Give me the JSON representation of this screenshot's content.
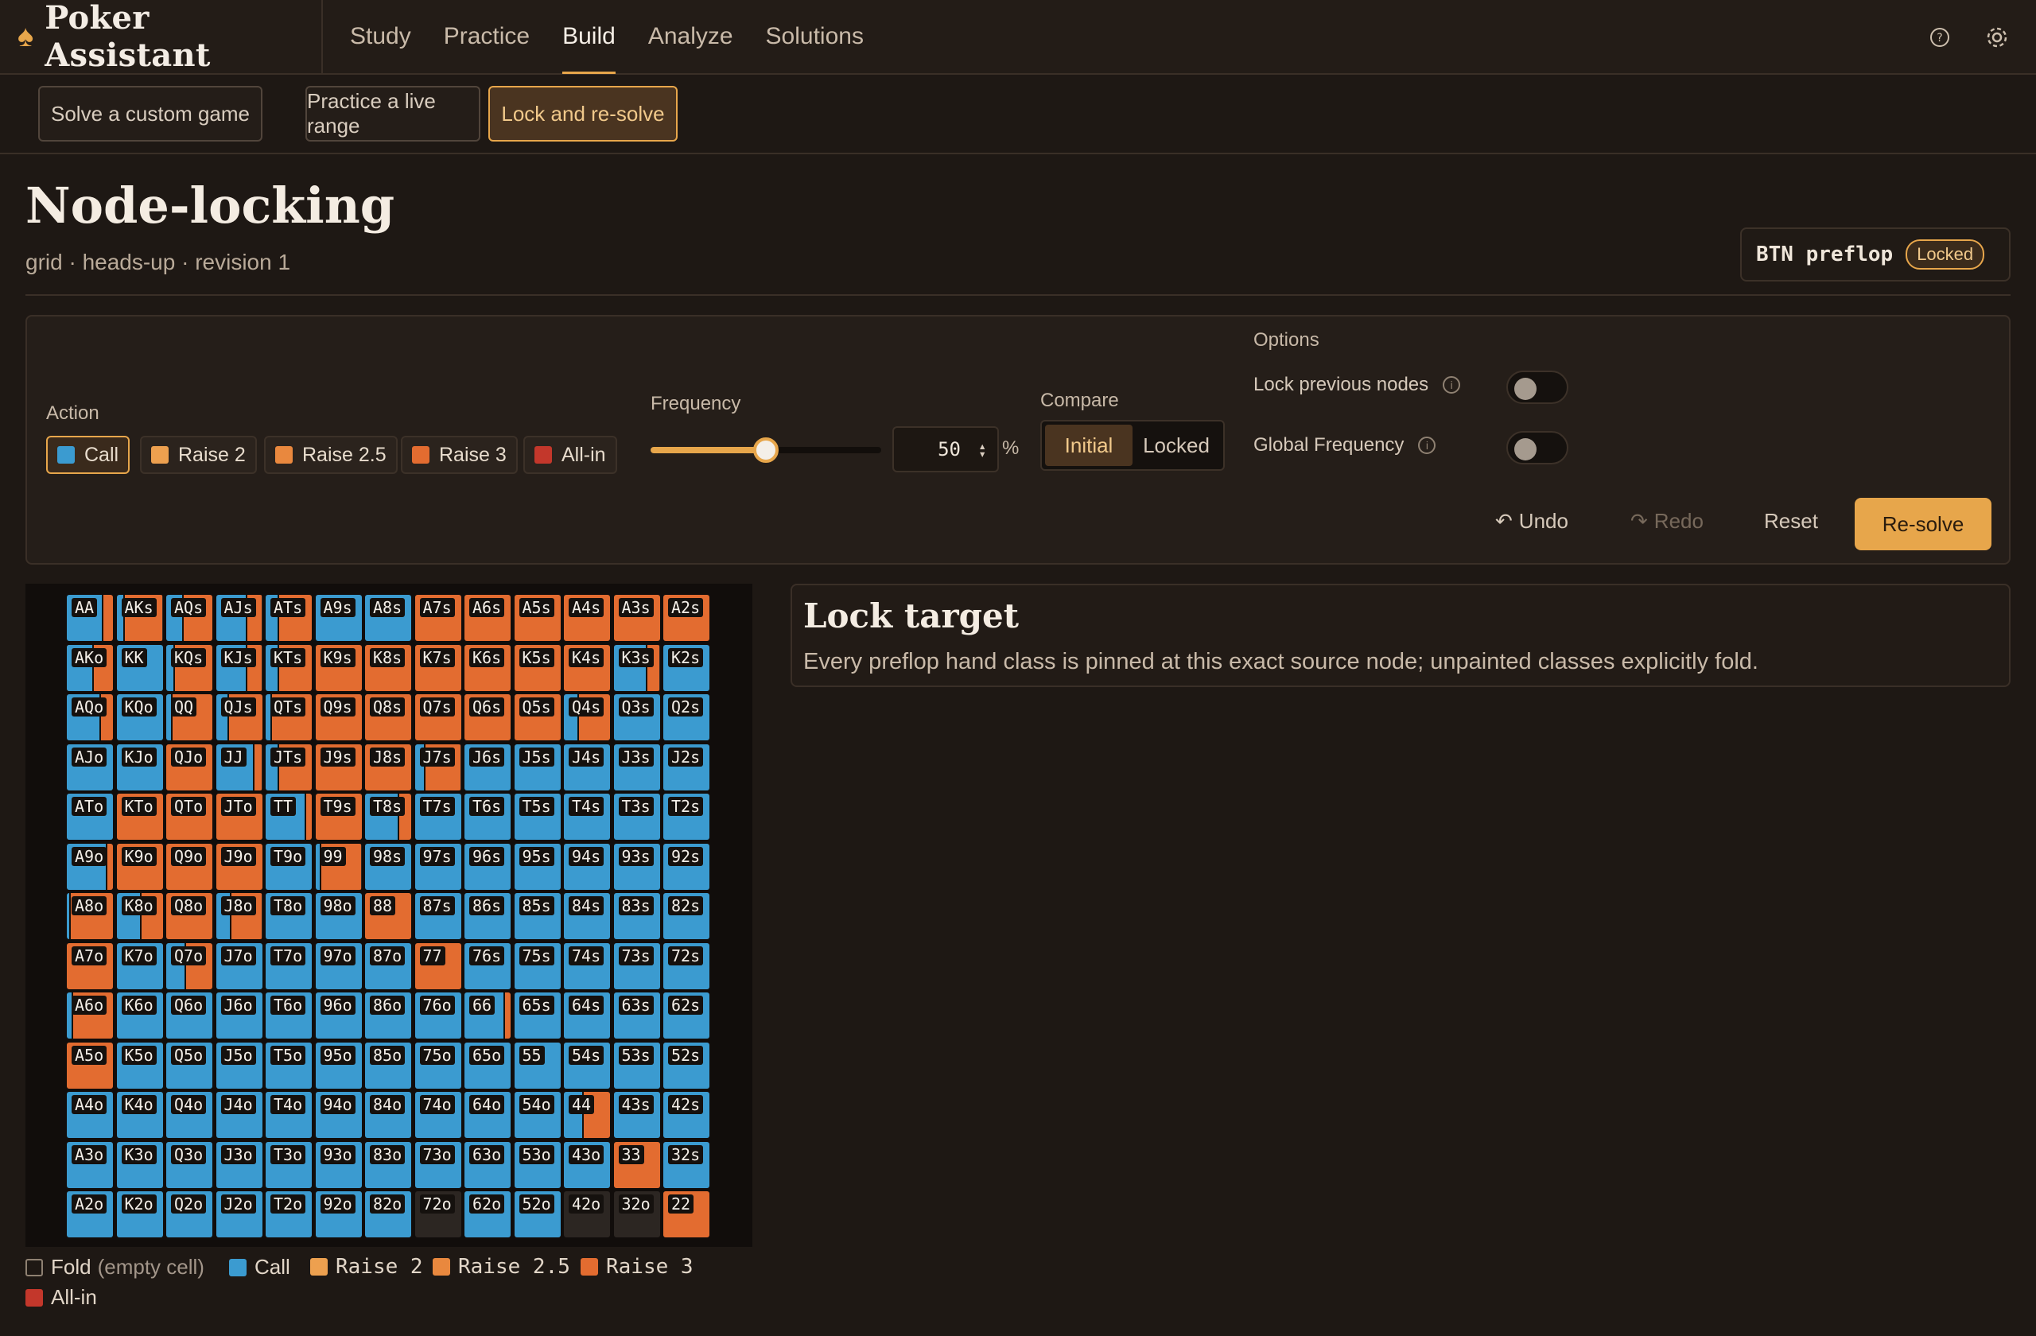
{
  "app": {
    "title": "Poker Assistant"
  },
  "nav": {
    "items": [
      "Study",
      "Practice",
      "Build",
      "Analyze",
      "Solutions"
    ],
    "active": "Build"
  },
  "subnav": {
    "tabs": [
      "Solve a custom game",
      "Practice a live range",
      "Lock and re-solve"
    ],
    "active": "Lock and re-solve"
  },
  "page": {
    "title": "Node-locking",
    "subtitle": "grid · heads-up · revision 1"
  },
  "node": {
    "label": "BTN preflop",
    "badge": "Locked"
  },
  "controls": {
    "action_label": "Action",
    "actions": [
      {
        "label": "Call",
        "color": "#3b9bd0"
      },
      {
        "label": "Raise 2",
        "color": "#eda04f"
      },
      {
        "label": "Raise 2.5",
        "color": "#e9883e"
      },
      {
        "label": "Raise 3",
        "color": "#e36c30"
      },
      {
        "label": "All-in",
        "color": "#c3372b"
      }
    ],
    "active_action": "Call",
    "frequency_label": "Frequency",
    "frequency_value": 50,
    "frequency_unit": "%",
    "compare_label": "Compare",
    "compare_options": [
      "Initial",
      "Locked"
    ],
    "compare_active": "Initial",
    "options_label": "Options",
    "options": [
      {
        "label": "Lock previous nodes",
        "enabled": false
      },
      {
        "label": "Global Frequency",
        "enabled": false
      }
    ],
    "undo": "Undo",
    "redo": "Redo",
    "reset": "Reset",
    "resolve": "Re-solve"
  },
  "lock_target": {
    "title": "Lock target",
    "description": "Every preflop hand class is pinned at this exact source node; unpainted classes explicitly fold."
  },
  "grid": {
    "selected": "AKo",
    "rows": [
      [
        "AA",
        "AKs",
        "AQs",
        "AJs",
        "ATs",
        "A9s",
        "A8s",
        "A7s",
        "A6s",
        "A5s",
        "A4s",
        "A3s",
        "A2s"
      ],
      [
        "AKo",
        "KK",
        "KQs",
        "KJs",
        "KTs",
        "K9s",
        "K8s",
        "K7s",
        "K6s",
        "K5s",
        "K4s",
        "K3s",
        "K2s"
      ],
      [
        "AQo",
        "KQo",
        "QQ",
        "QJs",
        "QTs",
        "Q9s",
        "Q8s",
        "Q7s",
        "Q6s",
        "Q5s",
        "Q4s",
        "Q3s",
        "Q2s"
      ],
      [
        "AJo",
        "KJo",
        "QJo",
        "JJ",
        "JTs",
        "J9s",
        "J8s",
        "J7s",
        "J6s",
        "J5s",
        "J4s",
        "J3s",
        "J2s"
      ],
      [
        "ATo",
        "KTo",
        "QTo",
        "JTo",
        "TT",
        "T9s",
        "T8s",
        "T7s",
        "T6s",
        "T5s",
        "T4s",
        "T3s",
        "T2s"
      ],
      [
        "A9o",
        "K9o",
        "Q9o",
        "J9o",
        "T9o",
        "99",
        "98s",
        "97s",
        "96s",
        "95s",
        "94s",
        "93s",
        "92s"
      ],
      [
        "A8o",
        "K8o",
        "Q8o",
        "J8o",
        "T8o",
        "98o",
        "88",
        "87s",
        "86s",
        "85s",
        "84s",
        "83s",
        "82s"
      ],
      [
        "A7o",
        "K7o",
        "Q7o",
        "J7o",
        "T7o",
        "97o",
        "87o",
        "77",
        "76s",
        "75s",
        "74s",
        "73s",
        "72s"
      ],
      [
        "A6o",
        "K6o",
        "Q6o",
        "J6o",
        "T6o",
        "96o",
        "86o",
        "76o",
        "66",
        "65s",
        "64s",
        "63s",
        "62s"
      ],
      [
        "A5o",
        "K5o",
        "Q5o",
        "J5o",
        "T5o",
        "95o",
        "85o",
        "75o",
        "65o",
        "55",
        "54s",
        "53s",
        "52s"
      ],
      [
        "A4o",
        "K4o",
        "Q4o",
        "J4o",
        "T4o",
        "94o",
        "84o",
        "74o",
        "64o",
        "54o",
        "44",
        "43s",
        "42s"
      ],
      [
        "A3o",
        "K3o",
        "Q3o",
        "J3o",
        "T3o",
        "93o",
        "83o",
        "73o",
        "63o",
        "53o",
        "43o",
        "33",
        "32s"
      ],
      [
        "A2o",
        "K2o",
        "Q2o",
        "J2o",
        "T2o",
        "92o",
        "82o",
        "72o",
        "62o",
        "52o",
        "42o",
        "32o",
        "22"
      ]
    ],
    "raise_fraction": [
      [
        0.25,
        0.85,
        0.65,
        0.35,
        0.75,
        0.0,
        0.0,
        1.0,
        1.0,
        1.0,
        1.0,
        1.0,
        1.0
      ],
      [
        0.45,
        0.0,
        0.85,
        0.35,
        0.75,
        1.0,
        1.0,
        1.0,
        1.0,
        1.0,
        1.0,
        0.3,
        0.0
      ],
      [
        0.3,
        0.0,
        0.9,
        0.75,
        0.9,
        1.0,
        1.0,
        1.0,
        1.0,
        1.0,
        0.7,
        0.0,
        0.0
      ],
      [
        0.0,
        0.0,
        1.0,
        0.2,
        0.75,
        1.0,
        1.0,
        0.8,
        0.0,
        0.0,
        0.0,
        0.0,
        0.0
      ],
      [
        0.0,
        1.0,
        1.0,
        1.0,
        0.15,
        1.0,
        0.3,
        0.0,
        0.0,
        0.0,
        0.0,
        0.0,
        0.0
      ],
      [
        0.15,
        1.0,
        1.0,
        1.0,
        0.0,
        0.9,
        0.0,
        0.0,
        0.0,
        0.0,
        0.0,
        0.0,
        0.0
      ],
      [
        0.95,
        0.5,
        1.0,
        0.7,
        0.0,
        0.0,
        1.0,
        0.0,
        0.0,
        0.0,
        0.0,
        0.0,
        0.0
      ],
      [
        1.0,
        0.0,
        0.6,
        0.0,
        0.0,
        0.0,
        0.0,
        1.0,
        0.0,
        0.0,
        0.0,
        0.0,
        0.0
      ],
      [
        0.9,
        0.0,
        0.0,
        0.0,
        0.0,
        0.0,
        0.0,
        0.0,
        0.15,
        0.0,
        0.0,
        0.0,
        0.0
      ],
      [
        1.0,
        0.0,
        0.0,
        0.0,
        0.0,
        0.0,
        0.0,
        0.0,
        0.0,
        0.0,
        0.0,
        0.0,
        0.0
      ],
      [
        0.0,
        0.0,
        0.0,
        0.0,
        0.0,
        0.0,
        0.0,
        0.0,
        0.0,
        0.0,
        0.6,
        0.0,
        0.0
      ],
      [
        0.0,
        0.0,
        0.0,
        0.0,
        0.0,
        0.0,
        0.0,
        0.0,
        0.0,
        0.0,
        0.0,
        1.0,
        0.0
      ],
      [
        0.0,
        0.0,
        0.0,
        0.0,
        0.0,
        0.0,
        0.0,
        0.0,
        0.0,
        0.0,
        0.0,
        0.0,
        1.0
      ]
    ],
    "fold_cells": [
      "72o",
      "42o",
      "32o"
    ]
  },
  "legend": {
    "fold": "Fold",
    "fold_note": "(empty cell)",
    "call": "Call",
    "raise2": "Raise 2",
    "raise25": "Raise 2.5",
    "raise3": "Raise 3",
    "allin": "All-in"
  }
}
